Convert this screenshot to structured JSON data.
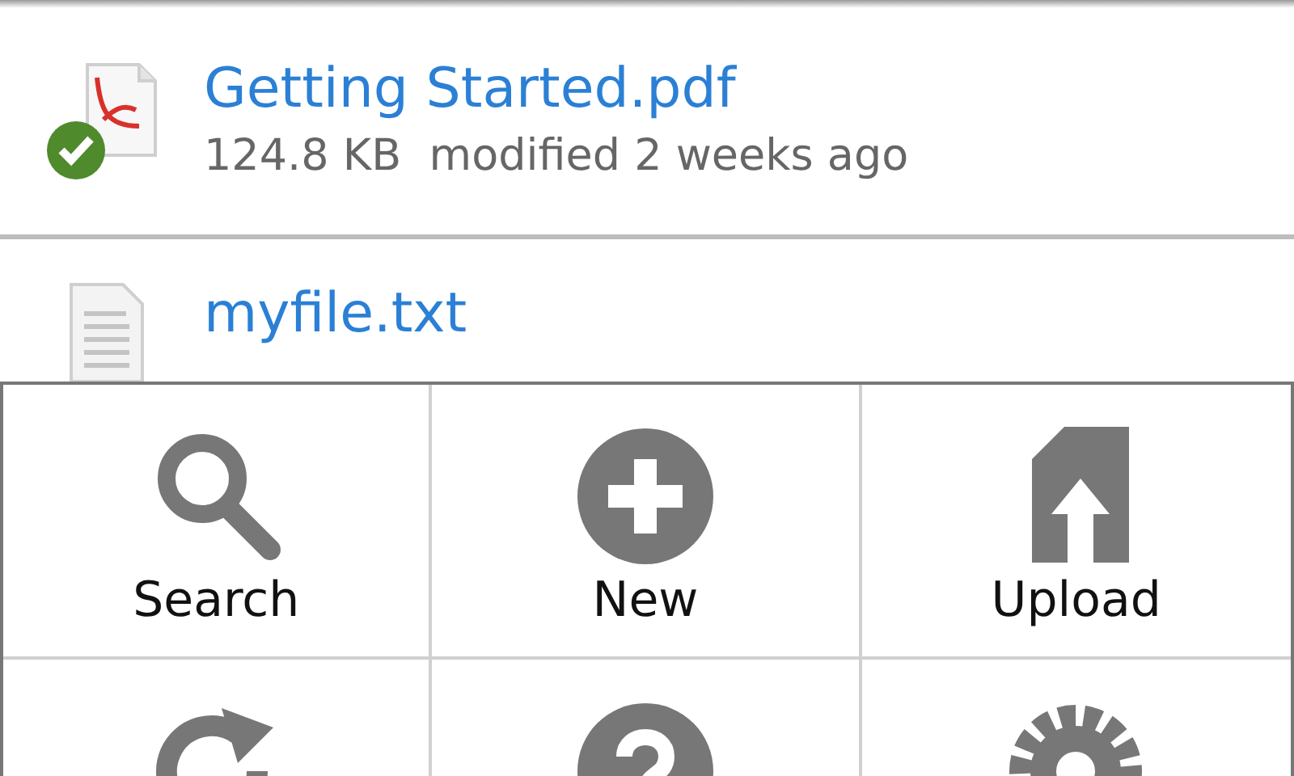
{
  "files": [
    {
      "kind": "pdf",
      "name": "Getting Started.pdf",
      "synced": true,
      "details": "124.8 KB  modified 2 weeks ago"
    },
    {
      "kind": "text",
      "name": "myfile.txt",
      "synced": false
    }
  ],
  "menu": [
    {
      "kind": "search",
      "label": "Search"
    },
    {
      "kind": "new",
      "label": "New"
    },
    {
      "kind": "upload",
      "label": "Upload"
    },
    {
      "kind": "refresh"
    },
    {
      "kind": "help"
    },
    {
      "kind": "settings"
    }
  ]
}
